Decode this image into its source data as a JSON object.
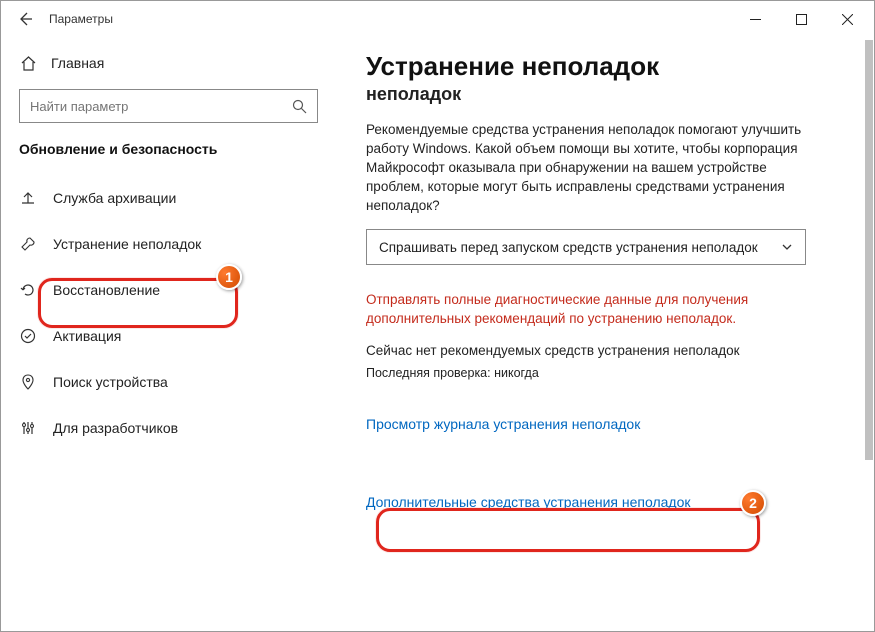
{
  "window": {
    "title": "Параметры"
  },
  "sidebar": {
    "home": "Главная",
    "search_placeholder": "Найти параметр",
    "section": "Обновление и безопасность",
    "items": [
      {
        "label": "Служба архивации"
      },
      {
        "label": "Устранение неполадок"
      },
      {
        "label": "Восстановление"
      },
      {
        "label": "Активация"
      },
      {
        "label": "Поиск устройства"
      },
      {
        "label": "Для разработчиков"
      }
    ]
  },
  "main": {
    "heading": "Устранение неполадок",
    "subheading": "неполадок",
    "description": "Рекомендуемые средства устранения неполадок помогают улучшить работу Windows. Какой объем помощи вы хотите, чтобы корпорация Майкрософт оказывала при обнаружении на вашем устройстве проблем, которые могут быть исправлены средствами устранения неполадок?",
    "dropdown_value": "Спрашивать перед запуском средств устранения неполадок",
    "warning_link": "Отправлять полные диагностические данные для получения дополнительных рекомендаций по устранению неполадок.",
    "status_line": "Сейчас нет рекомендуемых средств устранения неполадок",
    "last_check_label": "Последняя проверка:",
    "last_check_value": "никогда",
    "link_history": "Просмотр журнала устранения неполадок",
    "link_additional": "Дополнительные средства устранения неполадок"
  },
  "markers": {
    "one": "1",
    "two": "2"
  }
}
